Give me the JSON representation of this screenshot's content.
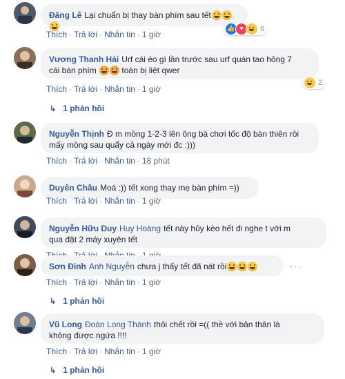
{
  "actions": {
    "like": "Thích",
    "reply": "Trả lời",
    "tag": "Nhắn tin"
  },
  "comments": [
    {
      "author": "Đăng Lê",
      "tag": "",
      "text": "Lại chuẩn bị thay bàn phím sau tết",
      "emojis": 3,
      "time": "1 giờ",
      "reactions": {
        "count": "6",
        "icons": [
          "like-icon",
          "love-icon",
          "haha-icon"
        ]
      },
      "replies": ""
    },
    {
      "author": "Vương Thanh Hải",
      "tag": "",
      "text_line1": "Urf cái éo gì lần trước sau urf quán tao hỏng 7",
      "text_line2": "cái bàn phím",
      "text_line2b": "toàn bị liệt qwer",
      "time": "1 giờ",
      "reactions": {
        "count": "2",
        "icons": [
          "haha-icon"
        ]
      },
      "replies": "1 phản hồi"
    },
    {
      "author": "Nguyễn Thịnh",
      "tag": "",
      "text_line1": "Đ m mồng 1-2-3 lên ông bà chơi tốc độ bàn thiên rồi",
      "text_line2": "mấy mồng sau quẩy cả ngày mới đc :)))",
      "time": "18 phút",
      "replies": ""
    },
    {
      "author": "Duyên Châu",
      "tag": "",
      "text": "Moá :)) tết xong thay mẹ bàn phím =))",
      "time": "1 giờ",
      "replies": ""
    },
    {
      "author": "Nguyễn Hữu Duy",
      "tag": "Huy Hoàng",
      "text_line1": "tết này hủy kèo hết đi nghe t với m",
      "text_line2": "qua đặt 2 máy xuyên tết",
      "time": "1 giờ",
      "replies": ""
    },
    {
      "author": "Sơn Đinh",
      "tag": "Anh Nguyễn",
      "text": "chưa j thấy tết đã nát rồi",
      "emojis": 3,
      "time": "1 giờ",
      "replies": "1 phản hồi"
    },
    {
      "author": "Vũ Long",
      "tag": "Đoàn Long Thành",
      "text_line1": "thôi chết rồi =(( thề với bản thân là",
      "text_line2": "không được ngứa !!!!",
      "time": "1 giờ",
      "replies": "1 phản hồi"
    }
  ],
  "colors": {
    "link": "#385898",
    "bubble": "#f2f3f5",
    "meta": "#606770"
  }
}
